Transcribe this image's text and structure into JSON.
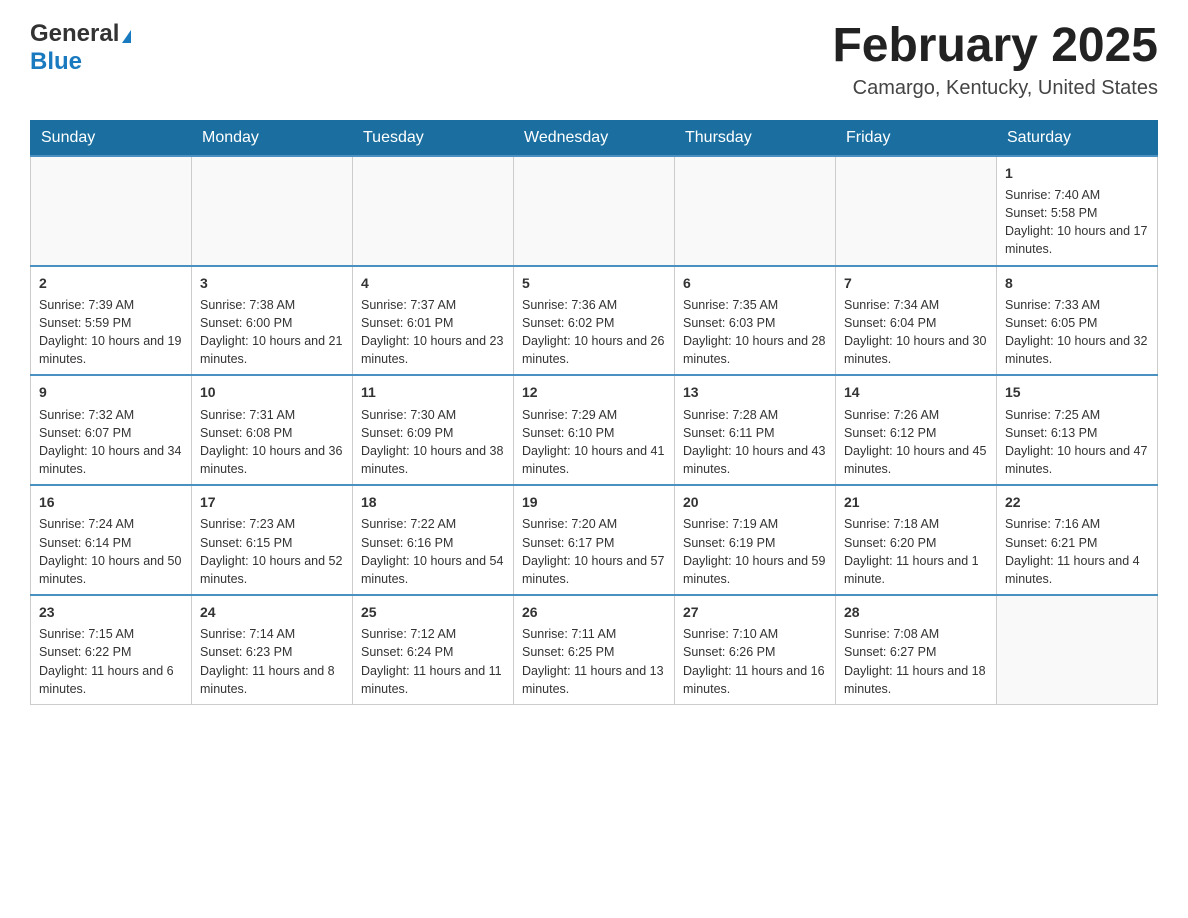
{
  "header": {
    "logo": {
      "general": "General",
      "blue": "Blue",
      "triangle": "▶"
    },
    "title": "February 2025",
    "location": "Camargo, Kentucky, United States"
  },
  "days_of_week": [
    "Sunday",
    "Monday",
    "Tuesday",
    "Wednesday",
    "Thursday",
    "Friday",
    "Saturday"
  ],
  "weeks": [
    {
      "days": [
        {
          "date": "",
          "empty": true
        },
        {
          "date": "",
          "empty": true
        },
        {
          "date": "",
          "empty": true
        },
        {
          "date": "",
          "empty": true
        },
        {
          "date": "",
          "empty": true
        },
        {
          "date": "",
          "empty": true
        },
        {
          "date": "1",
          "sunrise": "Sunrise: 7:40 AM",
          "sunset": "Sunset: 5:58 PM",
          "daylight": "Daylight: 10 hours and 17 minutes."
        }
      ]
    },
    {
      "days": [
        {
          "date": "2",
          "sunrise": "Sunrise: 7:39 AM",
          "sunset": "Sunset: 5:59 PM",
          "daylight": "Daylight: 10 hours and 19 minutes."
        },
        {
          "date": "3",
          "sunrise": "Sunrise: 7:38 AM",
          "sunset": "Sunset: 6:00 PM",
          "daylight": "Daylight: 10 hours and 21 minutes."
        },
        {
          "date": "4",
          "sunrise": "Sunrise: 7:37 AM",
          "sunset": "Sunset: 6:01 PM",
          "daylight": "Daylight: 10 hours and 23 minutes."
        },
        {
          "date": "5",
          "sunrise": "Sunrise: 7:36 AM",
          "sunset": "Sunset: 6:02 PM",
          "daylight": "Daylight: 10 hours and 26 minutes."
        },
        {
          "date": "6",
          "sunrise": "Sunrise: 7:35 AM",
          "sunset": "Sunset: 6:03 PM",
          "daylight": "Daylight: 10 hours and 28 minutes."
        },
        {
          "date": "7",
          "sunrise": "Sunrise: 7:34 AM",
          "sunset": "Sunset: 6:04 PM",
          "daylight": "Daylight: 10 hours and 30 minutes."
        },
        {
          "date": "8",
          "sunrise": "Sunrise: 7:33 AM",
          "sunset": "Sunset: 6:05 PM",
          "daylight": "Daylight: 10 hours and 32 minutes."
        }
      ]
    },
    {
      "days": [
        {
          "date": "9",
          "sunrise": "Sunrise: 7:32 AM",
          "sunset": "Sunset: 6:07 PM",
          "daylight": "Daylight: 10 hours and 34 minutes."
        },
        {
          "date": "10",
          "sunrise": "Sunrise: 7:31 AM",
          "sunset": "Sunset: 6:08 PM",
          "daylight": "Daylight: 10 hours and 36 minutes."
        },
        {
          "date": "11",
          "sunrise": "Sunrise: 7:30 AM",
          "sunset": "Sunset: 6:09 PM",
          "daylight": "Daylight: 10 hours and 38 minutes."
        },
        {
          "date": "12",
          "sunrise": "Sunrise: 7:29 AM",
          "sunset": "Sunset: 6:10 PM",
          "daylight": "Daylight: 10 hours and 41 minutes."
        },
        {
          "date": "13",
          "sunrise": "Sunrise: 7:28 AM",
          "sunset": "Sunset: 6:11 PM",
          "daylight": "Daylight: 10 hours and 43 minutes."
        },
        {
          "date": "14",
          "sunrise": "Sunrise: 7:26 AM",
          "sunset": "Sunset: 6:12 PM",
          "daylight": "Daylight: 10 hours and 45 minutes."
        },
        {
          "date": "15",
          "sunrise": "Sunrise: 7:25 AM",
          "sunset": "Sunset: 6:13 PM",
          "daylight": "Daylight: 10 hours and 47 minutes."
        }
      ]
    },
    {
      "days": [
        {
          "date": "16",
          "sunrise": "Sunrise: 7:24 AM",
          "sunset": "Sunset: 6:14 PM",
          "daylight": "Daylight: 10 hours and 50 minutes."
        },
        {
          "date": "17",
          "sunrise": "Sunrise: 7:23 AM",
          "sunset": "Sunset: 6:15 PM",
          "daylight": "Daylight: 10 hours and 52 minutes."
        },
        {
          "date": "18",
          "sunrise": "Sunrise: 7:22 AM",
          "sunset": "Sunset: 6:16 PM",
          "daylight": "Daylight: 10 hours and 54 minutes."
        },
        {
          "date": "19",
          "sunrise": "Sunrise: 7:20 AM",
          "sunset": "Sunset: 6:17 PM",
          "daylight": "Daylight: 10 hours and 57 minutes."
        },
        {
          "date": "20",
          "sunrise": "Sunrise: 7:19 AM",
          "sunset": "Sunset: 6:19 PM",
          "daylight": "Daylight: 10 hours and 59 minutes."
        },
        {
          "date": "21",
          "sunrise": "Sunrise: 7:18 AM",
          "sunset": "Sunset: 6:20 PM",
          "daylight": "Daylight: 11 hours and 1 minute."
        },
        {
          "date": "22",
          "sunrise": "Sunrise: 7:16 AM",
          "sunset": "Sunset: 6:21 PM",
          "daylight": "Daylight: 11 hours and 4 minutes."
        }
      ]
    },
    {
      "days": [
        {
          "date": "23",
          "sunrise": "Sunrise: 7:15 AM",
          "sunset": "Sunset: 6:22 PM",
          "daylight": "Daylight: 11 hours and 6 minutes."
        },
        {
          "date": "24",
          "sunrise": "Sunrise: 7:14 AM",
          "sunset": "Sunset: 6:23 PM",
          "daylight": "Daylight: 11 hours and 8 minutes."
        },
        {
          "date": "25",
          "sunrise": "Sunrise: 7:12 AM",
          "sunset": "Sunset: 6:24 PM",
          "daylight": "Daylight: 11 hours and 11 minutes."
        },
        {
          "date": "26",
          "sunrise": "Sunrise: 7:11 AM",
          "sunset": "Sunset: 6:25 PM",
          "daylight": "Daylight: 11 hours and 13 minutes."
        },
        {
          "date": "27",
          "sunrise": "Sunrise: 7:10 AM",
          "sunset": "Sunset: 6:26 PM",
          "daylight": "Daylight: 11 hours and 16 minutes."
        },
        {
          "date": "28",
          "sunrise": "Sunrise: 7:08 AM",
          "sunset": "Sunset: 6:27 PM",
          "daylight": "Daylight: 11 hours and 18 minutes."
        },
        {
          "date": "",
          "empty": true
        }
      ]
    }
  ]
}
